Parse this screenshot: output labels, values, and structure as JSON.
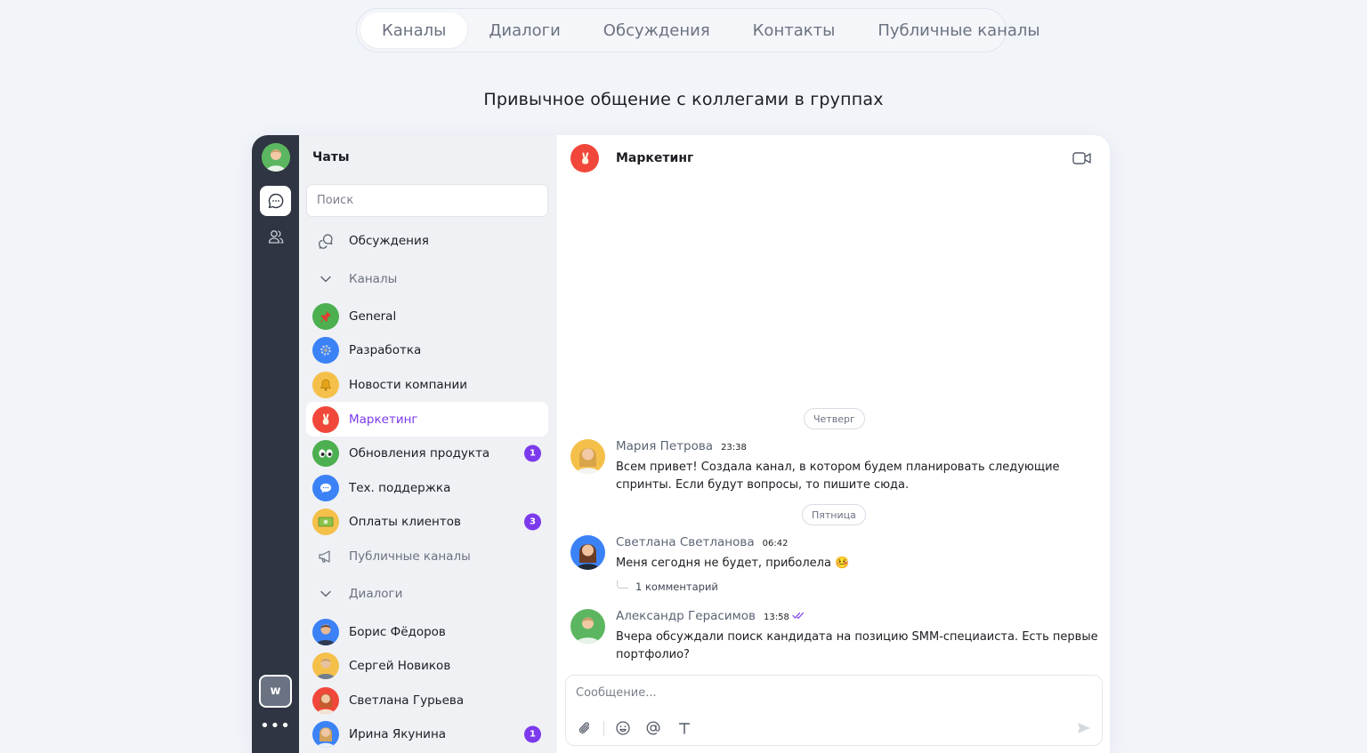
{
  "top_tabs": [
    {
      "label": "Каналы",
      "active": true
    },
    {
      "label": "Диалоги",
      "active": false
    },
    {
      "label": "Обсуждения",
      "active": false
    },
    {
      "label": "Контакты",
      "active": false
    },
    {
      "label": "Публичные каналы",
      "active": false
    }
  ],
  "tagline": "Привычное общение с коллегами в группах",
  "rail": {
    "workspace_letter": "w",
    "more": "•••"
  },
  "sidebar": {
    "title": "Чаты",
    "search_placeholder": "Поиск",
    "discussions": "Обсуждения",
    "channels_section": "Каналы",
    "channels": [
      {
        "label": "General",
        "icon": "pin-icon",
        "color": "#4caf50",
        "badge": ""
      },
      {
        "label": "Разработка",
        "icon": "gear-icon",
        "color": "#3b82f6",
        "badge": ""
      },
      {
        "label": "Новости компании",
        "icon": "bell-icon",
        "color": "#f5c04a",
        "badge": ""
      },
      {
        "label": "Маркетинг",
        "icon": "victory-hand-icon",
        "color": "#f1473b",
        "badge": ""
      },
      {
        "label": "Обновления продукта",
        "icon": "eyes-icon",
        "color": "#4caf50",
        "badge": "1"
      },
      {
        "label": "Тех. поддержка",
        "icon": "speech-bubble-icon",
        "color": "#3b82f6",
        "badge": ""
      },
      {
        "label": "Оплаты клиентов",
        "icon": "money-icon",
        "color": "#f5c04a",
        "badge": "3"
      }
    ],
    "public_channels": "Публичные каналы",
    "dialogs_section": "Диалоги",
    "dialogs": [
      {
        "label": "Борис Фёдоров",
        "color": "#3b82f6",
        "badge": ""
      },
      {
        "label": "Сергей Новиков",
        "color": "#f5c04a",
        "badge": ""
      },
      {
        "label": "Светлана Гурьева",
        "color": "#f1473b",
        "badge": ""
      },
      {
        "label": "Ирина Якунина",
        "color": "#3b82f6",
        "badge": "1"
      }
    ]
  },
  "chat": {
    "title": "Маркетинг",
    "day_thursday": "Четверг",
    "day_friday": "Пятница",
    "messages": [
      {
        "author": "Мария Петрова",
        "time": "23:38",
        "text": "Всем привет! Создала канал, в котором будем планировать следующие спринты. Если будут вопросы, то пишите сюда.",
        "avatar_color": "#f5c04a"
      },
      {
        "author": "Светлана Светланова",
        "time": "06:42",
        "text": "Меня сегодня не будет, приболела 🤒",
        "avatar_color": "#3b82f6"
      },
      {
        "author": "Александр Герасимов",
        "time": "13:58",
        "text": "Вчера обсуждали поиск кандидата на позицию SMM-специаиста. Есть первые портфолио?",
        "avatar_color": "#4caf50"
      }
    ],
    "comments": "1 комментарий",
    "composer_placeholder": "Сообщение...",
    "accent_color": "#7c3aed"
  }
}
